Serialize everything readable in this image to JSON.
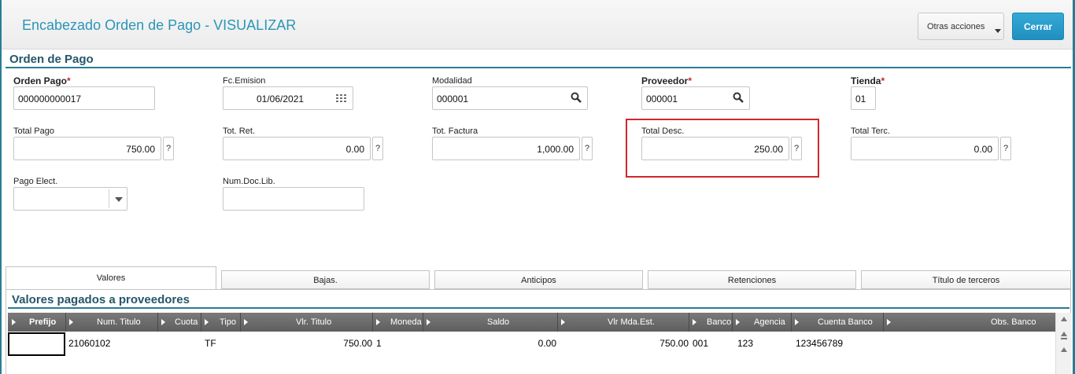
{
  "header": {
    "title": "Encabezado Orden de Pago - VISUALIZAR",
    "more_actions_label": "Otras acciones",
    "close_label": "Cerrar"
  },
  "form": {
    "section_title": "Orden de Pago",
    "orden_pago": {
      "label": "Orden Pago",
      "value": "000000000017",
      "required": true
    },
    "fc_emision": {
      "label": "Fc.Emision",
      "value": "01/06/2021"
    },
    "modalidad": {
      "label": "Modalidad",
      "value": "000001"
    },
    "proveedor": {
      "label": "Proveedor",
      "value": "000001",
      "required": true
    },
    "tienda": {
      "label": "Tienda",
      "value": "01",
      "required": true
    },
    "total_pago": {
      "label": "Total Pago",
      "value": "750.00"
    },
    "tot_ret": {
      "label": "Tot. Ret.",
      "value": "0.00"
    },
    "tot_factura": {
      "label": "Tot. Factura",
      "value": "1,000.00"
    },
    "total_desc": {
      "label": "Total Desc.",
      "value": "250.00"
    },
    "total_terc": {
      "label": "Total Terc.",
      "value": "0.00"
    },
    "pago_elect": {
      "label": "Pago Elect.",
      "value": ""
    },
    "num_doc_lib": {
      "label": "Num.Doc.Lib.",
      "value": ""
    },
    "help_glyph": "?",
    "required_mark": "*"
  },
  "tabs": [
    {
      "label": "Valores",
      "active": true
    },
    {
      "label": "Bajas.",
      "active": false
    },
    {
      "label": "Anticipos",
      "active": false
    },
    {
      "label": "Retenciones",
      "active": false
    },
    {
      "label": "Título de terceros",
      "active": false
    }
  ],
  "grid": {
    "title": "Valores pagados a proveedores",
    "columns": [
      "Prefijo",
      "Num. Titulo",
      "Cuota",
      "Tipo",
      "Vlr. Titulo",
      "Moneda",
      "Saldo",
      "Vlr Mda.Est.",
      "Banco",
      "Agencia",
      "Cuenta Banco",
      "Obs. Banco"
    ],
    "rows": [
      {
        "prefijo": "",
        "num_titulo": "21060102",
        "cuota": "",
        "tipo": "TF",
        "vlr_titulo": "750.00",
        "moneda": "1",
        "saldo": "0.00",
        "vlr_mda_est": "750.00",
        "banco": "001",
        "agencia": "123",
        "cuenta_banco": "123456789",
        "obs_banco": ""
      }
    ]
  },
  "colors": {
    "accent": "#2a96b8",
    "section": "#25566a",
    "primary_button": "#208fc0",
    "highlight": "#d3262b",
    "grid_header": "#6b6b6b"
  },
  "icons": [
    "search-icon",
    "calendar-icon",
    "chevron-down-icon",
    "question-icon",
    "scroll-up-icon"
  ]
}
